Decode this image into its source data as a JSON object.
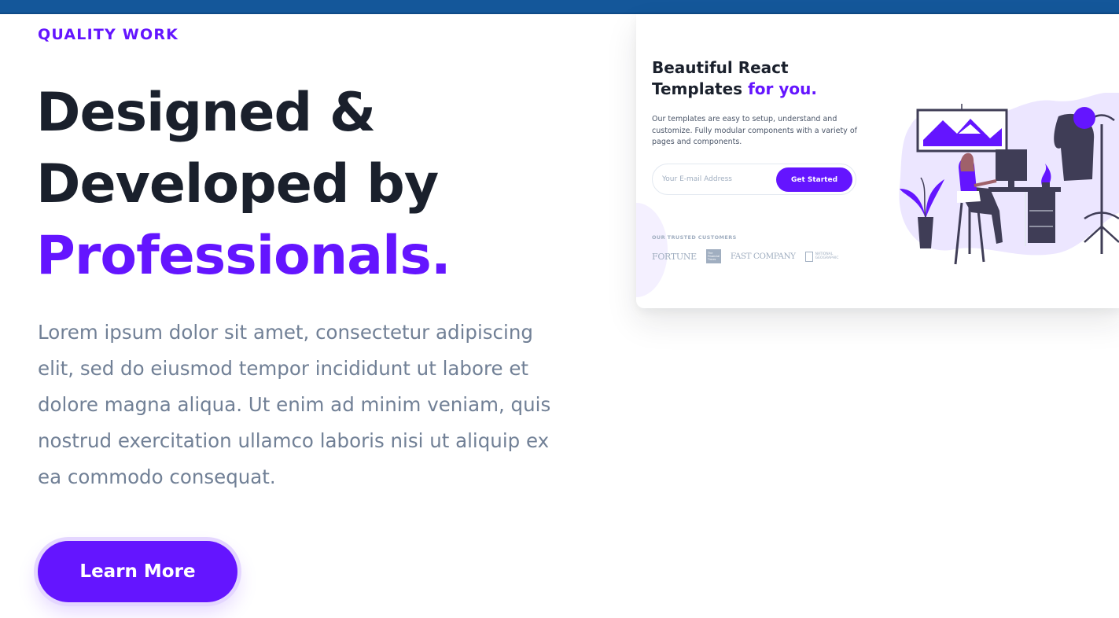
{
  "hero": {
    "eyebrow": "QUALITY WORK",
    "headline_line1": "Designed &",
    "headline_line2": "Developed by",
    "headline_accent": "Professionals.",
    "description": "Lorem ipsum dolor sit amet, consectetur adipiscing elit, sed do eiusmod tempor incididunt ut labore et dolore magna aliqua. Ut enim ad minim veniam, quis nostrud exercitation ullamco laboris nisi ut aliquip ex ea commodo consequat.",
    "cta_label": "Learn More"
  },
  "preview": {
    "title_line1": "Beautiful React",
    "title_line2": "Templates",
    "title_accent": "for you.",
    "text": "Our templates are easy to setup, understand and customize. Fully modular components with a variety of pages and components.",
    "email_placeholder": "Your E-mail Address",
    "submit_label": "Get Started",
    "trusted_label": "OUR TRUSTED CUSTOMERS",
    "customer_logos": {
      "fortune": "FORTUNE",
      "ft": "The Financial Times",
      "fast_company": "FAST COMPANY",
      "natgeo": "NATIONAL GEOGRAPHIC"
    }
  },
  "colors": {
    "brand_primary": "#6415ff",
    "heading": "#1a202c",
    "body_text": "#718096",
    "top_bar": "#14579a"
  }
}
